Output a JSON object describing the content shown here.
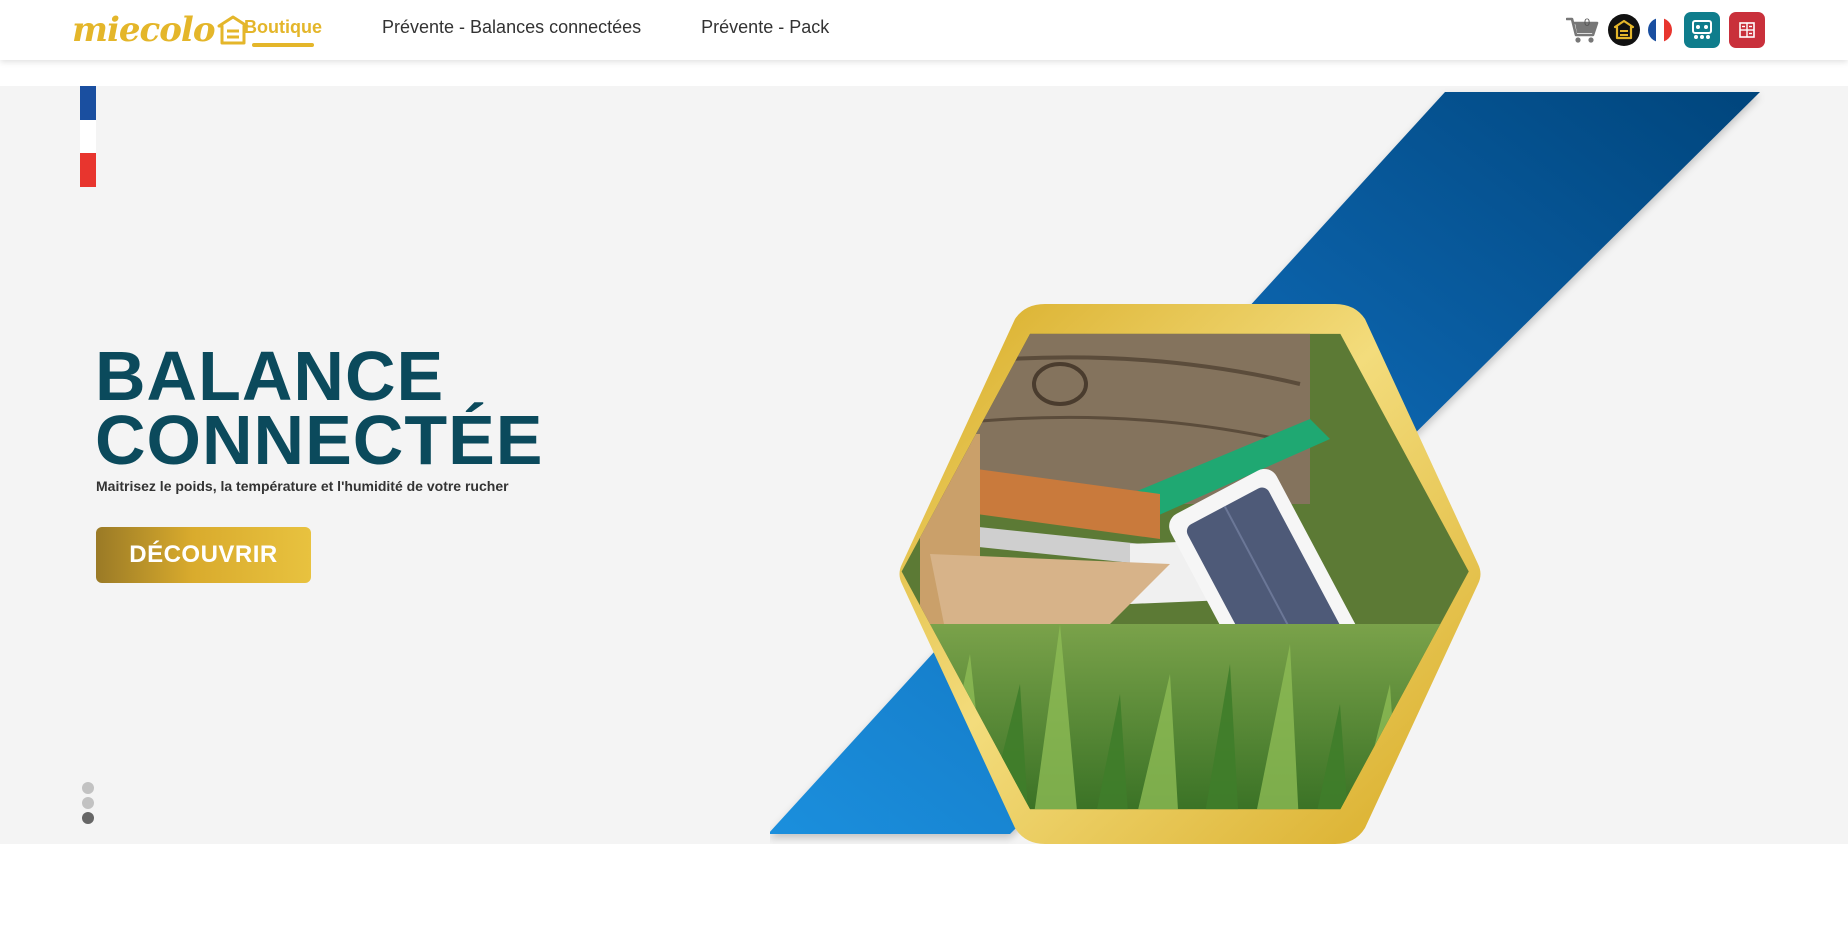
{
  "brand": {
    "name": "miecolo",
    "color": "#e4b62a"
  },
  "nav": {
    "items": [
      {
        "label": "Boutique",
        "active": true
      },
      {
        "label": "Prévente - Balances connectées",
        "active": false
      },
      {
        "label": "Prévente - Pack",
        "active": false
      }
    ]
  },
  "header": {
    "cart_count": "0",
    "icons": [
      "cart-icon",
      "hive-icon",
      "french-flag-icon",
      "team-app-icon",
      "calculator-app-icon"
    ]
  },
  "hero": {
    "title_line1": "BALANCE",
    "title_line2": "CONNECTÉE",
    "subtitle": "Maitrisez le poids, la température et l'humidité de votre rucher",
    "cta_label": "DÉCOUVRIR",
    "slide_count": 3,
    "active_slide": 3,
    "colors": {
      "title": "#0b4a5c",
      "band": "#0a5fa8",
      "gold": "#e4b62a",
      "background": "#f4f4f4"
    }
  }
}
